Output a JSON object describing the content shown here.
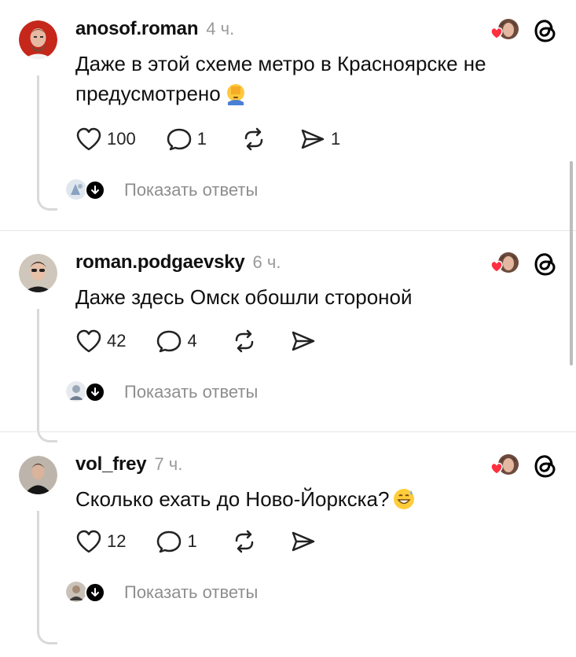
{
  "posts": [
    {
      "username": "anosof.roman",
      "time": "4 ч.",
      "text": "Даже в этой схеме метро в Красноярске не предусмотрено",
      "emoji": "face-palm",
      "likes": "100",
      "comments": "1",
      "reposts": "",
      "shares": "1",
      "show_replies": "Показать ответы",
      "avatar_color": "#c5271b"
    },
    {
      "username": "roman.podgaevsky",
      "time": "6 ч.",
      "text": "Даже здесь Омск обошли стороной",
      "emoji": "",
      "likes": "42",
      "comments": "4",
      "reposts": "",
      "shares": "",
      "show_replies": "Показать ответы",
      "avatar_color": "#c9c2b7"
    },
    {
      "username": "vol_frey",
      "time": "7 ч.",
      "text": "Сколько ехать до Ново-Йоркска?",
      "emoji": "grinning-sweat",
      "likes": "12",
      "comments": "1",
      "reposts": "",
      "shares": "",
      "show_replies": "Показать ответы",
      "avatar_color": "#b8b0a6"
    }
  ],
  "icons": {
    "like": "heart-icon",
    "comment": "comment-bubble-icon",
    "repost": "repost-icon",
    "share": "send-icon",
    "threads": "threads-logo-icon",
    "liked_by": "liked-by-author-icon"
  },
  "colors": {
    "accent_red": "#ff3040",
    "muted": "#8e8e8e",
    "divider": "#e6e6e6"
  }
}
